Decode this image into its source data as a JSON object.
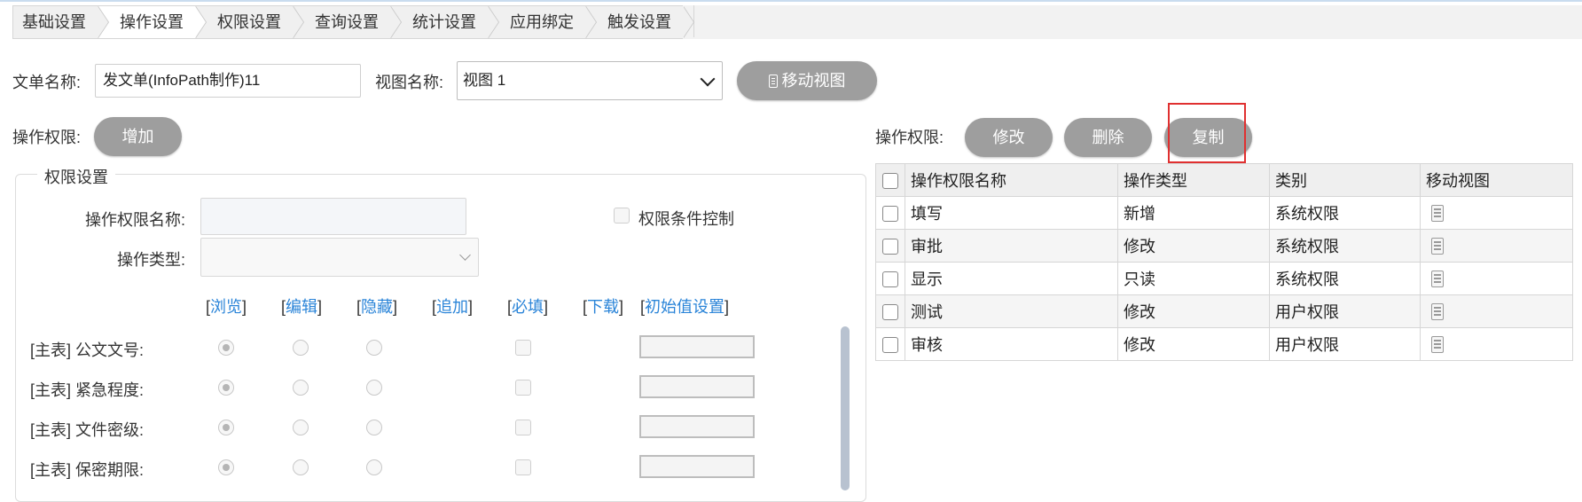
{
  "tabs": [
    "基础设置",
    "操作设置",
    "权限设置",
    "查询设置",
    "统计设置",
    "应用绑定",
    "触发设置"
  ],
  "active_tab": "操作设置",
  "form": {
    "doc_name_label": "文单名称:",
    "doc_name_value": "发文单(InfoPath制作)11",
    "view_name_label": "视图名称:",
    "view_name_value": "视图 1",
    "mobile_view_button": "移动视图"
  },
  "left": {
    "perm_label": "操作权限:",
    "add_button": "增加",
    "fieldset_legend": "权限设置",
    "perm_name_label": "操作权限名称:",
    "perm_name_value": "",
    "op_type_label": "操作类型:",
    "op_type_value": "",
    "condition_label": "权限条件控制",
    "column_headers": [
      "浏览",
      "编辑",
      "隐藏",
      "追加",
      "必填",
      "下载",
      "初始值设置"
    ],
    "fields": [
      {
        "label": "[主表] 公文文号:"
      },
      {
        "label": "[主表] 紧急程度:"
      },
      {
        "label": "[主表] 文件密级:"
      },
      {
        "label": "[主表] 保密期限:"
      }
    ]
  },
  "right": {
    "perm_label": "操作权限:",
    "edit_button": "修改",
    "delete_button": "删除",
    "copy_button": "复制",
    "table_headers": [
      "操作权限名称",
      "操作类型",
      "类别",
      "移动视图"
    ],
    "rows": [
      {
        "name": "填写",
        "type": "新增",
        "category": "系统权限",
        "icon": "doc-icon"
      },
      {
        "name": "审批",
        "type": "修改",
        "category": "系统权限",
        "icon": "doc-icon"
      },
      {
        "name": "显示",
        "type": "只读",
        "category": "系统权限",
        "icon": "doc-icon"
      },
      {
        "name": "测试",
        "type": "修改",
        "category": "用户权限",
        "icon": "doc-icon"
      },
      {
        "name": "审核",
        "type": "修改",
        "category": "用户权限",
        "icon": "doc-icon"
      }
    ]
  },
  "colors": {
    "button_grey": "#9e9e9e",
    "link_blue": "#2a84d8",
    "highlight_red": "#e03030"
  }
}
